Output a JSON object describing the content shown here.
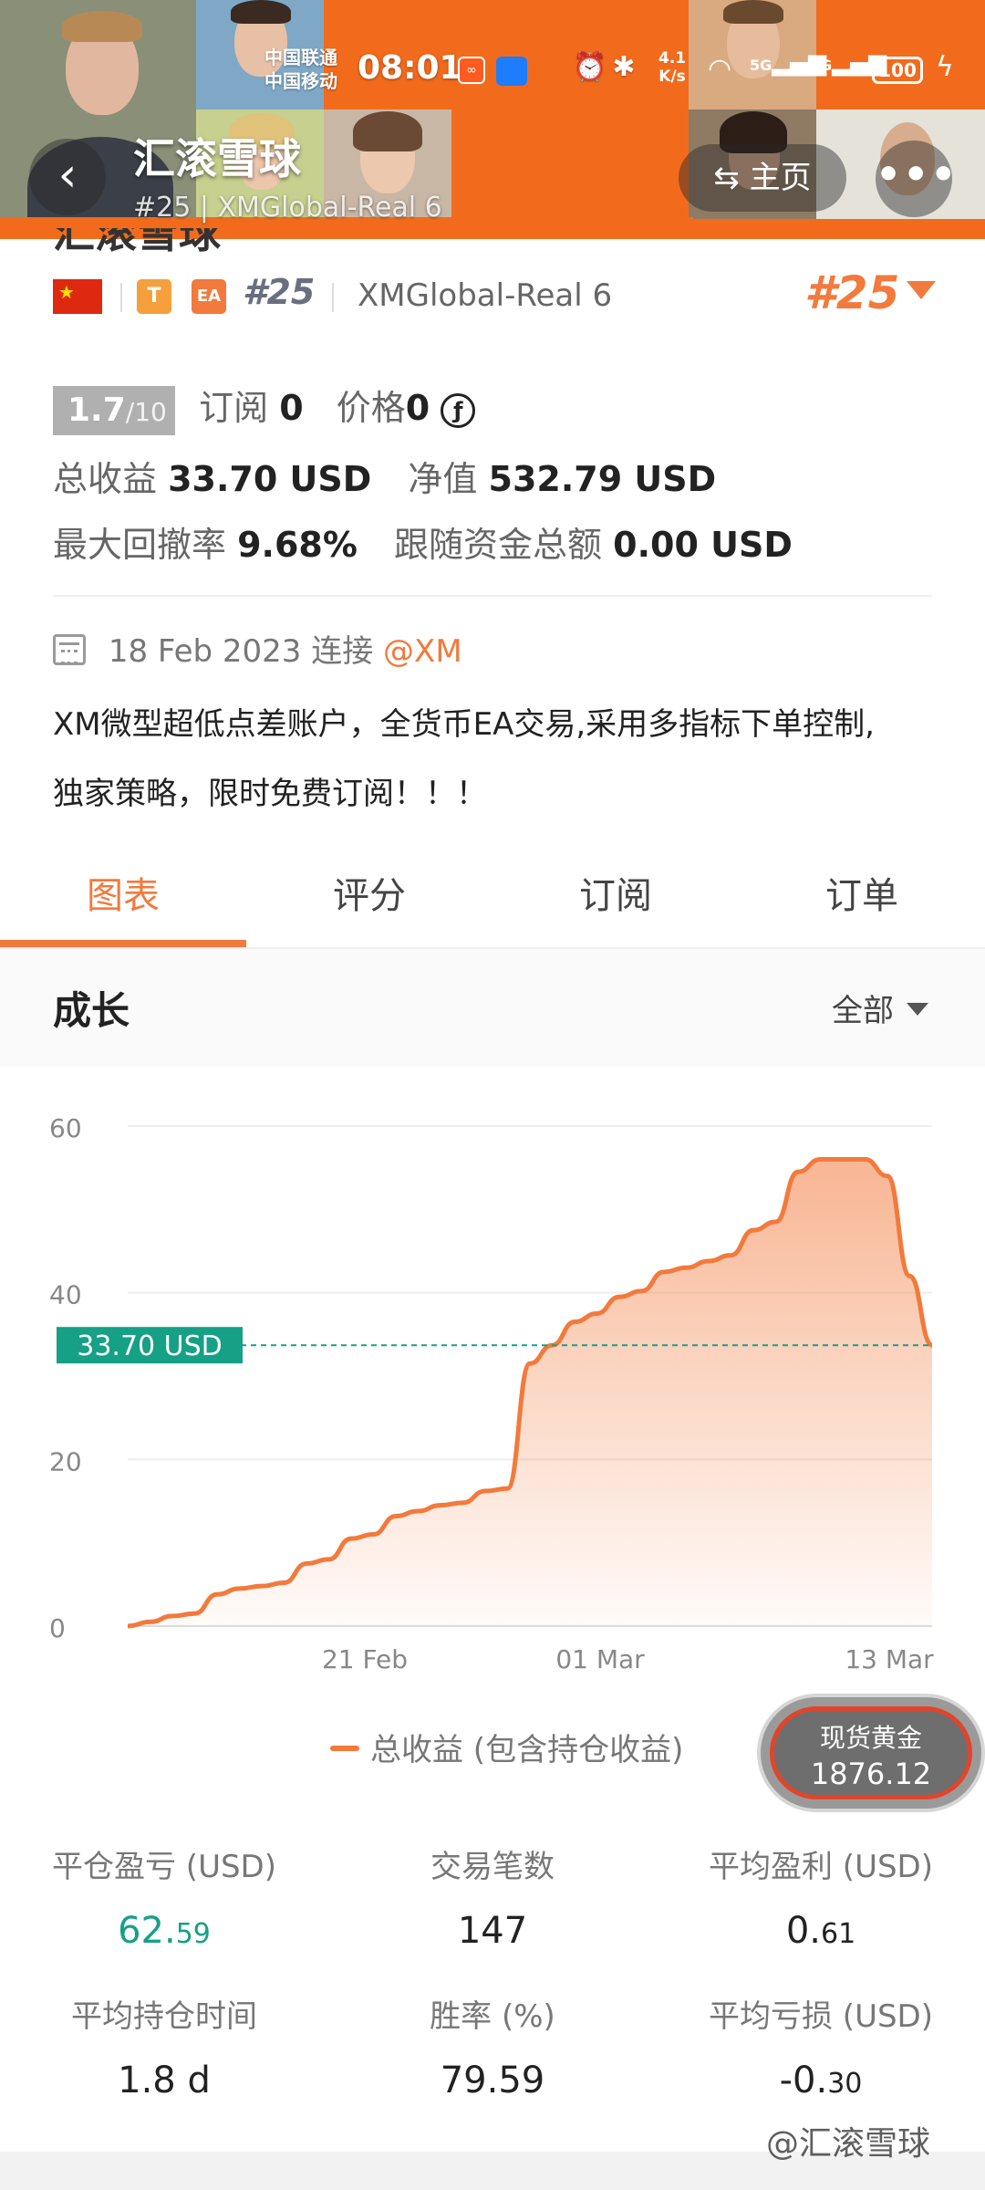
{
  "status_bar": {
    "carrier_1": "中国联通",
    "carrier_2": "中国移动",
    "time": "08:01",
    "net_speed_value": "4.1",
    "net_speed_unit": "K/s",
    "signal_1": "5G",
    "signal_2": "4G",
    "battery": "100"
  },
  "header": {
    "title": "汇滚雪球",
    "subtitle": "#25 | XMGlobal-Real 6",
    "home_label": "主页",
    "back_icon": "chevron-left-icon",
    "home_icon": "swap-icon",
    "more_icon": "more-dots-icon"
  },
  "account": {
    "name": "汇滚雪球",
    "badge_t": "T",
    "badge_ea": "EA",
    "rank": "#25",
    "server": "XMGlobal-Real 6",
    "rank_big": "#25",
    "score": "1.7",
    "score_max": "/10",
    "subscribe_label": "订阅",
    "subscribe_value": "0",
    "price_label": "价格",
    "price_value": "0",
    "total_profit_label": "总收益",
    "total_profit_value": "33.70 USD",
    "equity_label": "净值",
    "equity_value": "532.79 USD",
    "max_drawdown_label": "最大回撤率",
    "max_drawdown_value": "9.68%",
    "follow_funds_label": "跟随资金总额",
    "follow_funds_value": "0.00 USD",
    "connected_date": "18 Feb 2023 连接",
    "broker": "@XM",
    "description_line1": "XM微型超低点差账户，全货币EA交易,采用多指标下单控制,",
    "description_line2": "独家策略，限时免费订阅！！！"
  },
  "tabs": [
    "图表",
    "评分",
    "订阅",
    "订单"
  ],
  "growth": {
    "title": "成长",
    "range": "全部"
  },
  "chart_data": {
    "type": "area",
    "x_labels": [
      "21 Feb",
      "01 Mar",
      "13 Mar"
    ],
    "y_ticks": [
      0,
      20,
      40,
      60
    ],
    "ylim": [
      0,
      60
    ],
    "current_value_label": "33.70 USD",
    "current_value": 33.7,
    "series": [
      {
        "name": "总收益 (包含持仓收益)",
        "color": "#f27a3c",
        "values": [
          0,
          0.5,
          1.2,
          1.5,
          3.8,
          4.5,
          4.8,
          5.2,
          7.5,
          8.0,
          10.5,
          11.0,
          13.2,
          13.8,
          14.5,
          14.8,
          16.2,
          16.5,
          31.5,
          33.7,
          36.5,
          37.5,
          39.5,
          40.2,
          42.5,
          43.0,
          43.8,
          44.5,
          47.5,
          48.5,
          54.5,
          56.0,
          56.0,
          56.0,
          54.0,
          42.0,
          33.7
        ]
      }
    ],
    "grid": true
  },
  "legend": {
    "label": "总收益 (包含持仓收益)"
  },
  "gold_widget": {
    "label": "现货黄金",
    "price": "1876.12"
  },
  "metrics": [
    {
      "label": "平仓盈亏 (USD)",
      "value_main": "62.",
      "value_small": "59",
      "color": "#16a085"
    },
    {
      "label": "交易笔数",
      "value_main": "147",
      "value_small": ""
    },
    {
      "label": "平均盈利 (USD)",
      "value_main": "0.",
      "value_small": "61"
    },
    {
      "label": "平均持仓时间",
      "value_main": "1.8 d",
      "value_small": ""
    },
    {
      "label": "胜率 (%)",
      "value_main": "79.59",
      "value_small": ""
    },
    {
      "label": "平均亏损 (USD)",
      "value_main": "-0.",
      "value_small": "30"
    }
  ],
  "watermark": "@汇滚雪球",
  "colors": {
    "accent": "#f27a3c",
    "positive": "#16a085",
    "header_orange": "#f26b1d"
  }
}
